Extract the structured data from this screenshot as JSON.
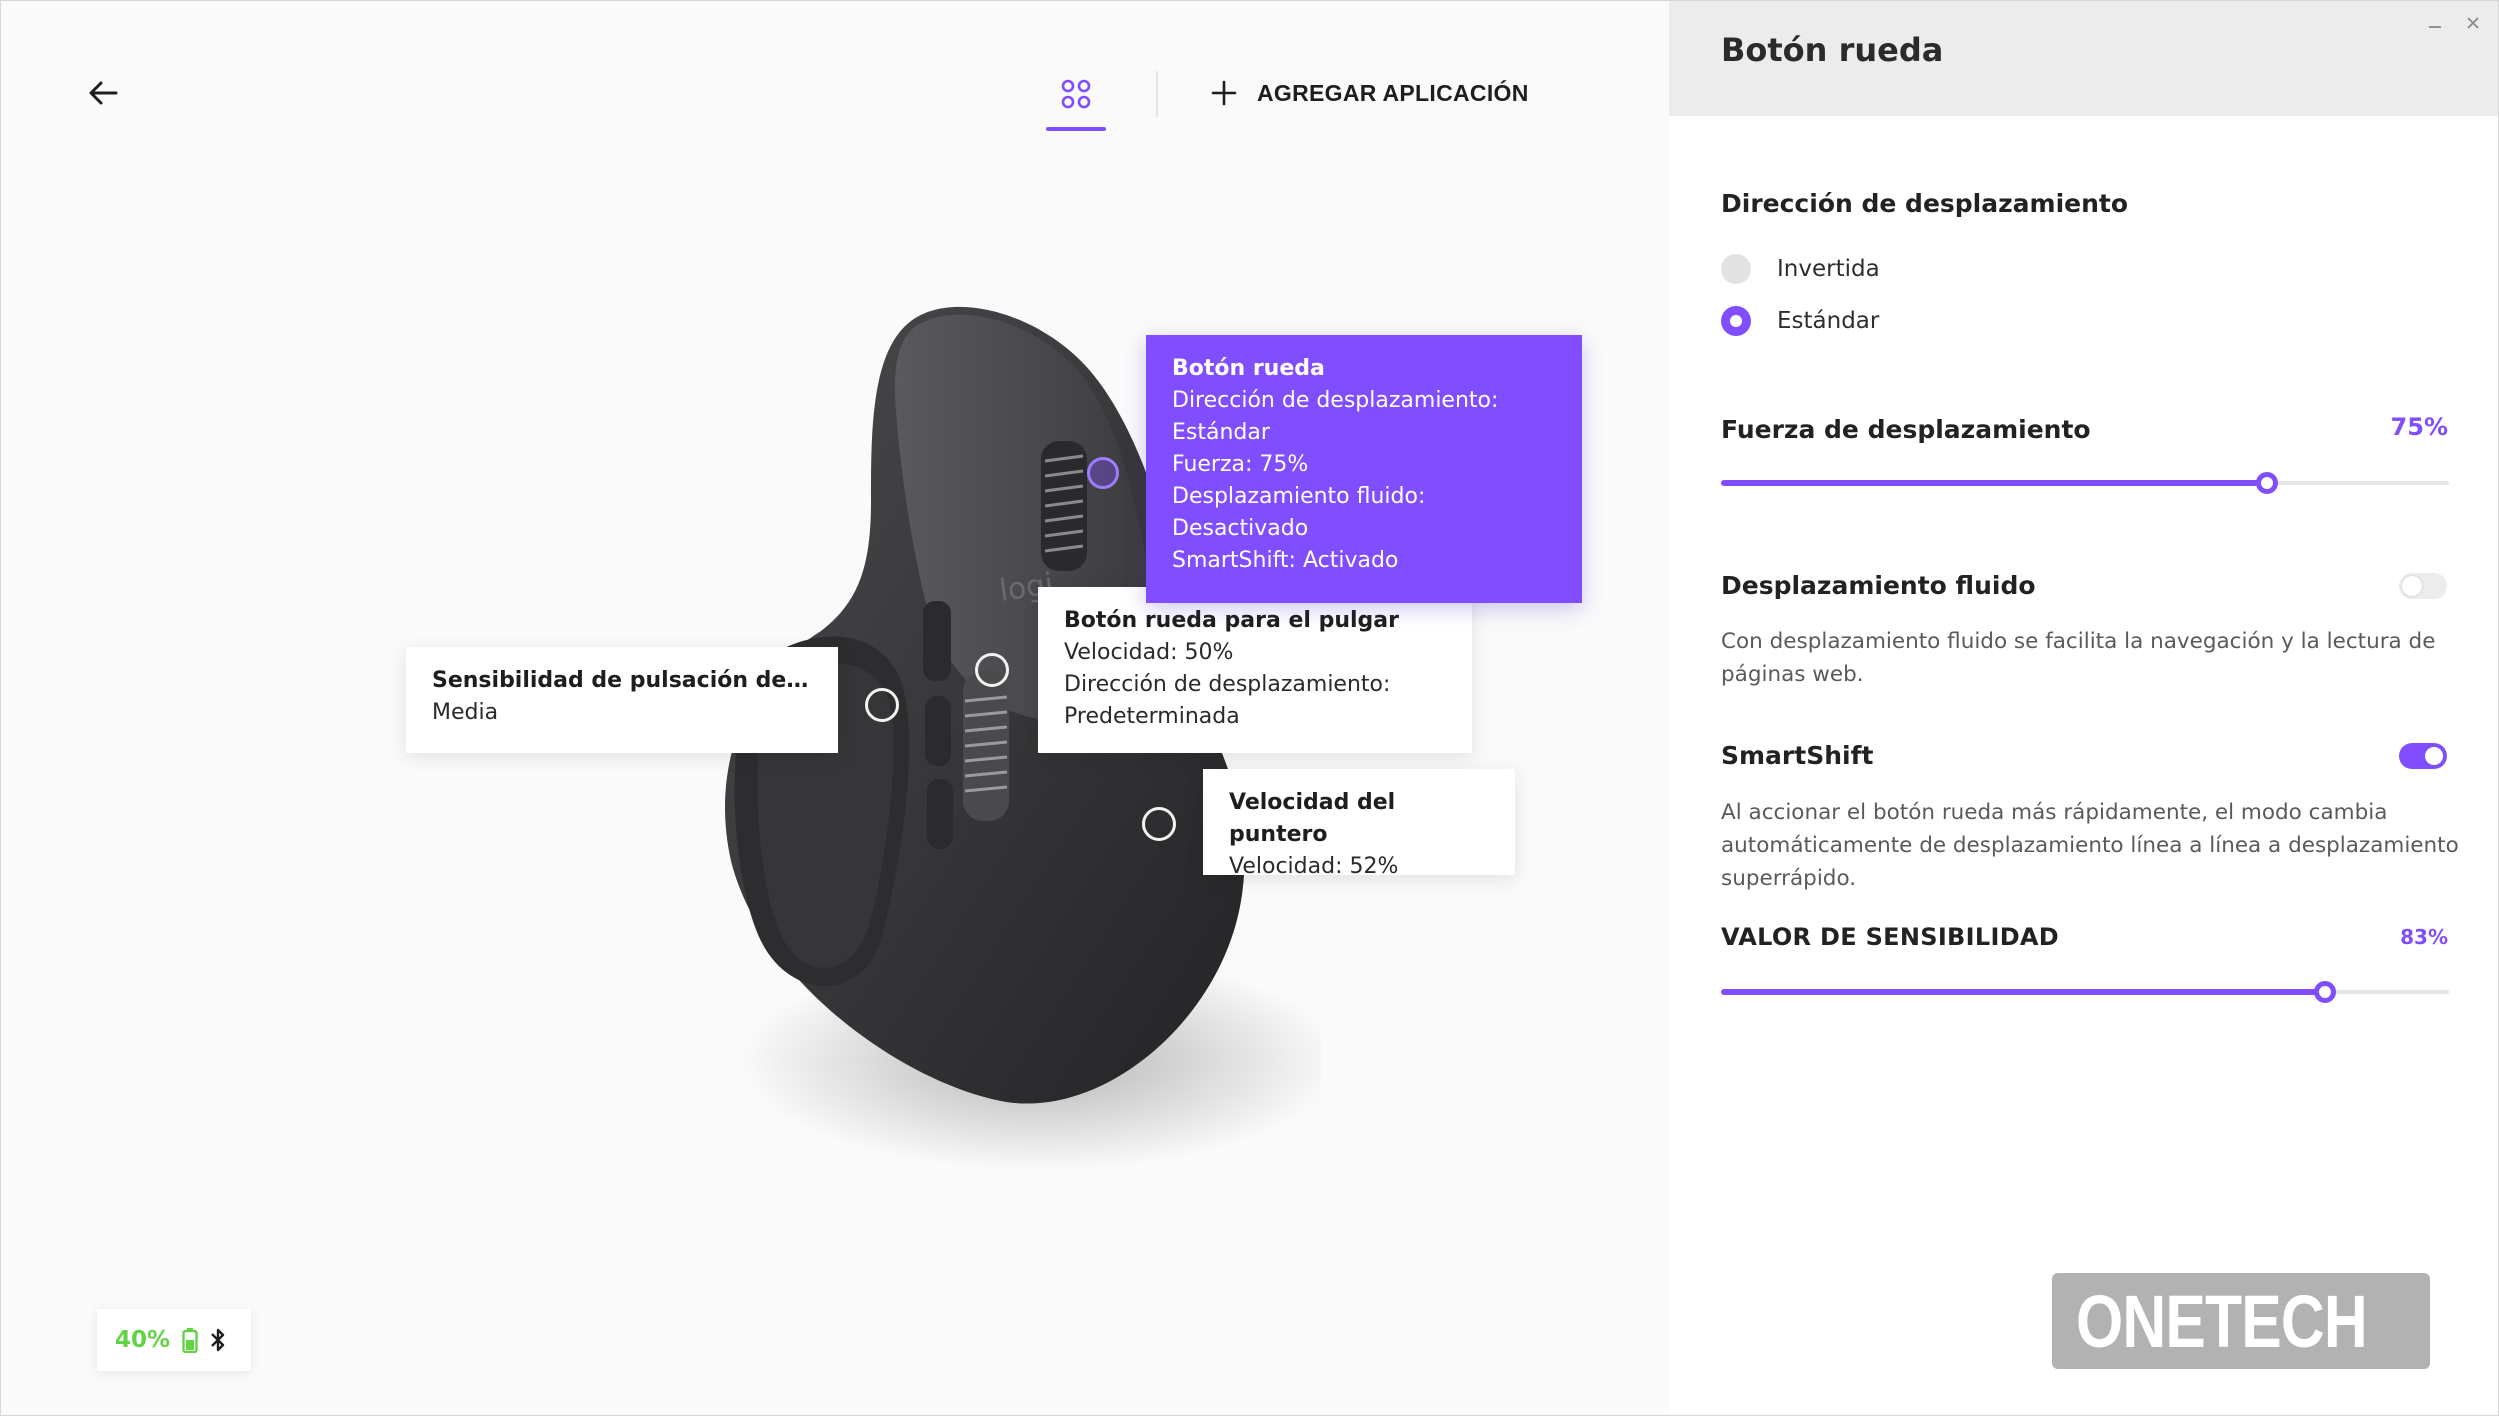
{
  "toolbar": {
    "add_app_label": "AGREGAR APLICACIÓN"
  },
  "callouts": {
    "wheel": {
      "title": "Botón rueda",
      "lines": [
        "Dirección de desplazamiento:",
        "Estándar",
        "Fuerza: 75%",
        "Desplazamiento fluido:",
        "Desactivado",
        "SmartShift: Activado"
      ]
    },
    "thumbwheel": {
      "title": "Botón rueda para el pulgar",
      "lines": [
        "Velocidad: 50%",
        "Dirección de desplazamiento:",
        "Predeterminada"
      ]
    },
    "gesture": {
      "title": "Sensibilidad de pulsación del ...",
      "lines": [
        "Media"
      ]
    },
    "pointer": {
      "title": "Velocidad del puntero",
      "lines": [
        "Velocidad: 52%"
      ]
    }
  },
  "battery": {
    "percent_label": "40%",
    "color": "#62d246"
  },
  "panel": {
    "title": "Botón rueda",
    "scroll_direction": {
      "title": "Dirección de desplazamiento",
      "options": [
        {
          "label": "Invertida",
          "selected": false
        },
        {
          "label": "Estándar",
          "selected": true
        }
      ]
    },
    "scroll_force": {
      "title": "Fuerza de desplazamiento",
      "value_label": "75%",
      "value": 0.75
    },
    "smooth_scroll": {
      "title": "Desplazamiento fluido",
      "enabled": false,
      "description": "Con desplazamiento fluido se facilita la navegación y la lectura de páginas web."
    },
    "smartshift": {
      "title": "SmartShift",
      "enabled": true,
      "description": "Al accionar el botón rueda más rápidamente, el modo cambia automáticamente de desplazamiento línea a línea a desplazamiento superrápido."
    },
    "sensitivity": {
      "title": "VALOR DE SENSIBILIDAD",
      "value_label": "83%",
      "value": 0.83
    }
  },
  "watermark": {
    "text": "ONETECH"
  },
  "colors": {
    "accent": "#814eff",
    "panel_header": "#ececec"
  },
  "icons": [
    "back-arrow-icon",
    "apps-grid-icon",
    "plus-icon",
    "battery-icon",
    "bluetooth-icon",
    "minimize-icon",
    "close-icon"
  ]
}
